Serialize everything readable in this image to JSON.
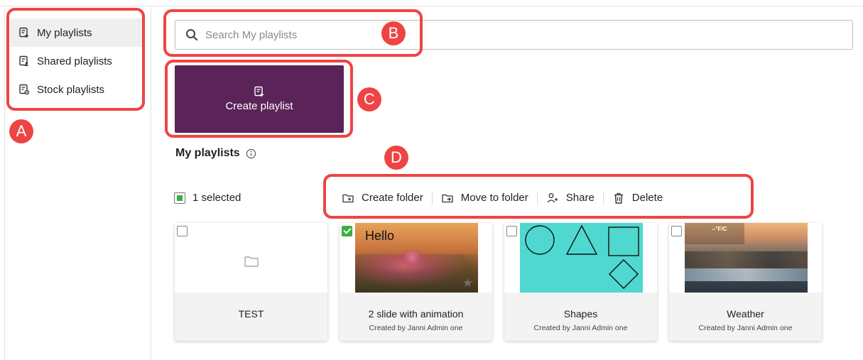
{
  "sidebar": {
    "items": [
      {
        "label": "My playlists",
        "icon": "playlist-add-icon",
        "active": true
      },
      {
        "label": "Shared playlists",
        "icon": "shared-playlist-icon",
        "active": false
      },
      {
        "label": "Stock playlists",
        "icon": "stock-playlist-icon",
        "active": false
      }
    ]
  },
  "search": {
    "placeholder": "Search My playlists",
    "value": ""
  },
  "create": {
    "label": "Create playlist"
  },
  "section": {
    "title": "My playlists"
  },
  "selection": {
    "label": "1 selected"
  },
  "toolbar": {
    "create_folder": "Create folder",
    "move_to_folder": "Move to folder",
    "share": "Share",
    "delete": "Delete"
  },
  "cards": [
    {
      "name": "TEST",
      "creator": "",
      "type": "folder",
      "checked": false
    },
    {
      "name": "2 slide with animation",
      "creator": "Created by Janni Admin one",
      "thumb_text": "Hello",
      "checked": true
    },
    {
      "name": "Shapes",
      "creator": "Created by Janni Admin one",
      "checked": false
    },
    {
      "name": "Weather",
      "creator": "Created by Janni Admin one",
      "thumb_text": "--°F/C",
      "checked": false
    }
  ],
  "annotations": {
    "a": "A",
    "b": "B",
    "c": "C",
    "d": "D"
  },
  "colors": {
    "brand": "#5a2459",
    "check": "#3fae3f",
    "annotation": "#ef4444"
  }
}
